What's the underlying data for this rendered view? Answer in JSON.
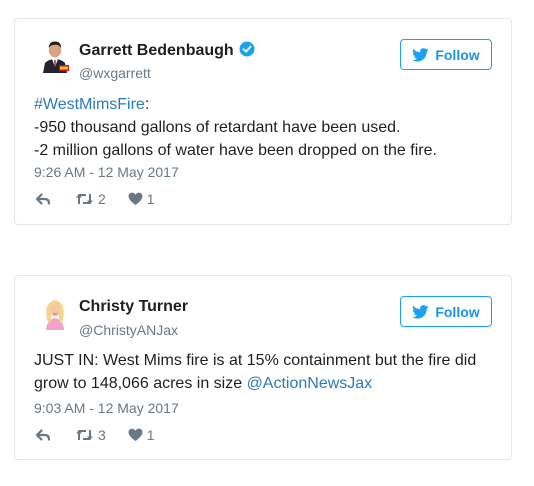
{
  "tweets": [
    {
      "author": "Garrett Bedenbaugh",
      "verified": true,
      "handle": "@wxgarrett",
      "follow_label": "Follow",
      "hashtag": "#WestMimsFire",
      "hashtag_suffix": ":",
      "line2": "-950 thousand gallons of retardant have been used.",
      "line3": "-2 million gallons of water have been dropped on the fire.",
      "timestamp": "9:26 AM - 12 May 2017",
      "retweets": "2",
      "likes": "1"
    },
    {
      "author": "Christy Turner",
      "verified": false,
      "handle": "@ChristyANJax",
      "follow_label": "Follow",
      "text": "JUST IN: West Mims fire is at 15% containment but the fire did grow to 148,066 acres in size ",
      "mention": "@ActionNewsJax",
      "timestamp": "9:03 AM - 12 May 2017",
      "retweets": "3",
      "likes": "1"
    }
  ],
  "colors": {
    "link": "#2b7bb9",
    "follow_border": "#1da1f2",
    "follow_text": "#1b95e0",
    "muted": "#697882"
  },
  "icons": [
    "verified-badge-icon",
    "twitter-bird-icon",
    "reply-icon",
    "retweet-icon",
    "heart-icon"
  ]
}
